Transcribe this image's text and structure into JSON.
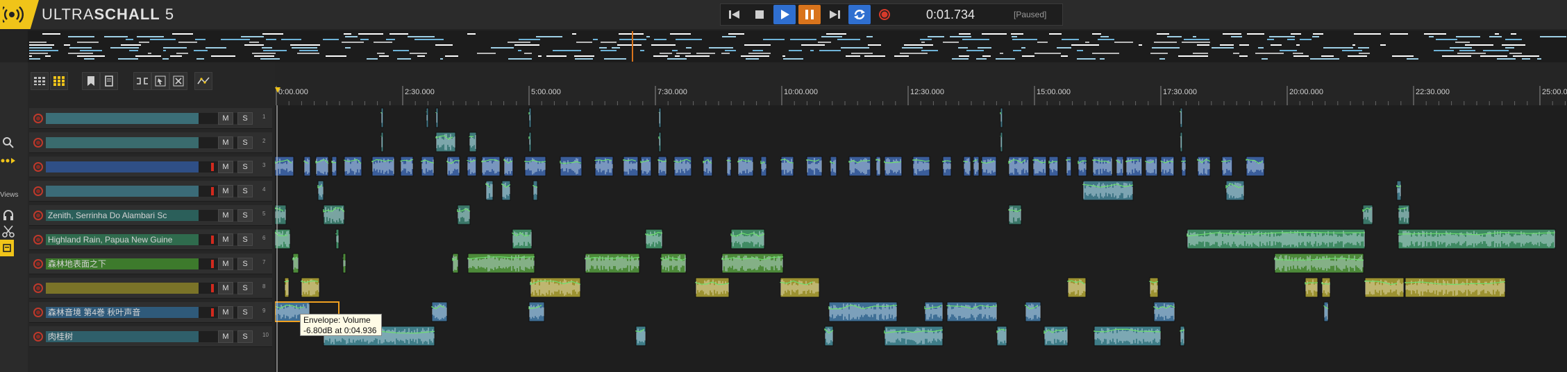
{
  "app": {
    "title_light": "ULTRA",
    "title_bold": "SCHALL",
    "title_version": "5",
    "accent_color": "#f0c419"
  },
  "transport": {
    "buttons": [
      {
        "name": "go-to-start-button",
        "icon": "skip-back-icon"
      },
      {
        "name": "stop-button",
        "icon": "stop-icon"
      },
      {
        "name": "play-button",
        "icon": "play-icon"
      },
      {
        "name": "pause-button",
        "icon": "pause-icon"
      },
      {
        "name": "go-to-end-button",
        "icon": "skip-forward-icon"
      },
      {
        "name": "loop-button",
        "icon": "loop-icon"
      },
      {
        "name": "record-button",
        "icon": "record-icon"
      }
    ],
    "time": "0:01.734",
    "status": "[Paused]"
  },
  "sidebar": {
    "views_label": "Views",
    "icons": [
      "zoom-icon",
      "routing-icon",
      "headphones-icon",
      "scissors-icon",
      "storyboard-icon"
    ]
  },
  "toolbar": {
    "icons": [
      "grid-small-icon",
      "grid-large-icon",
      "bookmark-icon",
      "bookmark-list-icon",
      "split-icon",
      "ripple-icon",
      "cut-ripple-icon",
      "envelope-icon"
    ]
  },
  "ruler": {
    "labels": [
      "0:00.000",
      "2:30.000",
      "5:00.000",
      "7:30.000",
      "10:00.000",
      "12:30.000",
      "15:00.000",
      "17:30.000",
      "20:00.000",
      "22:30.000",
      "25:00.000"
    ]
  },
  "tracks": [
    {
      "number": "1",
      "name": "",
      "color": "#3b6e77",
      "mute": "M",
      "solo": "S",
      "meter": false
    },
    {
      "number": "2",
      "name": "",
      "color": "#3a6b6e",
      "mute": "M",
      "solo": "S",
      "meter": false
    },
    {
      "number": "3",
      "name": "",
      "color": "#2f4f86",
      "mute": "M",
      "solo": "S",
      "meter": true
    },
    {
      "number": "4",
      "name": "",
      "color": "#3b6b78",
      "mute": "M",
      "solo": "S",
      "meter": true
    },
    {
      "number": "5",
      "name": "Zenith, Serrinha Do Alambari Sc",
      "color": "#2b5f5a",
      "mute": "M",
      "solo": "S",
      "meter": false
    },
    {
      "number": "6",
      "name": "Highland Rain, Papua New Guine",
      "color": "#2f6b4d",
      "mute": "M",
      "solo": "S",
      "meter": true
    },
    {
      "number": "7",
      "name": "森林地表面之下",
      "color": "#3d7a2c",
      "mute": "M",
      "solo": "S",
      "meter": true
    },
    {
      "number": "8",
      "name": "",
      "color": "#7a7328",
      "mute": "M",
      "solo": "S",
      "meter": true
    },
    {
      "number": "9",
      "name": "森林音境 第4巻 秋叶声音",
      "color": "#2f5a7a",
      "mute": "M",
      "solo": "S",
      "meter": true
    },
    {
      "number": "10",
      "name": "肉桂树",
      "color": "#2f5f6a",
      "mute": "M",
      "solo": "S",
      "meter": false
    }
  ],
  "tooltip": {
    "line1": "Envelope: Volume",
    "line2": "-6.80dB at 0:04.936"
  }
}
